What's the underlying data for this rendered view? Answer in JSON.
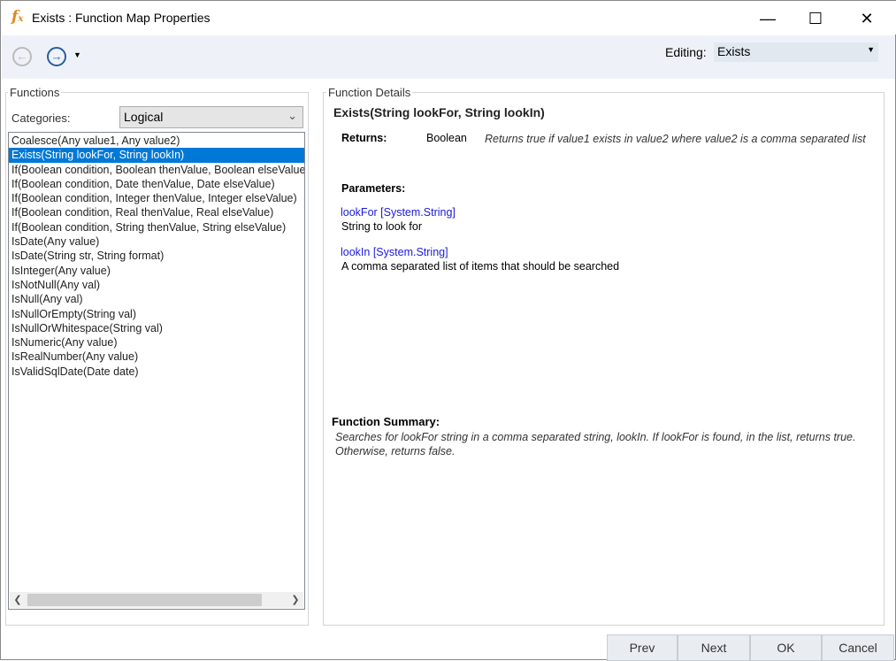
{
  "window": {
    "title": "Exists : Function Map Properties",
    "icon": "fx-icon",
    "controls": [
      "minimize",
      "maximize",
      "close"
    ]
  },
  "toolbar": {
    "back_icon": "back-arrow-icon",
    "forward_icon": "forward-arrow-icon",
    "editing_label": "Editing:",
    "editing_value": "Exists"
  },
  "functions": {
    "group_label": "Functions",
    "categories_label": "Categories:",
    "category_value": "Logical",
    "items": [
      "Coalesce(Any value1, Any value2)",
      "Exists(String lookFor, String lookIn)",
      "If(Boolean condition, Boolean thenValue, Boolean elseValue)",
      "If(Boolean condition, Date thenValue, Date elseValue)",
      "If(Boolean condition, Integer thenValue, Integer elseValue)",
      "If(Boolean condition, Real thenValue, Real elseValue)",
      "If(Boolean condition, String thenValue, String elseValue)",
      "IsDate(Any value)",
      "IsDate(String str, String format)",
      "IsInteger(Any value)",
      "IsNotNull(Any val)",
      "IsNull(Any val)",
      "IsNullOrEmpty(String val)",
      "IsNullOrWhitespace(String val)",
      "IsNumeric(Any value)",
      "IsRealNumber(Any value)",
      "IsValidSqlDate(Date date)"
    ],
    "selected_index": 1
  },
  "details": {
    "group_label": "Function Details",
    "signature": "Exists(String lookFor, String lookIn)",
    "returns_label": "Returns:",
    "returns_type": "Boolean",
    "returns_desc": "Returns true if value1 exists in value2 where value2 is a comma separated list",
    "parameters_label": "Parameters:",
    "params": [
      {
        "name": "lookFor [System.String]",
        "desc": "String to look for"
      },
      {
        "name": "lookIn [System.String]",
        "desc": "A comma separated list of items that should be searched"
      }
    ],
    "summary_label": "Function Summary:",
    "summary": "Searches for lookFor string in a comma separated string, lookIn. If lookFor is found, in the list, returns true. Otherwise, returns false."
  },
  "buttons": {
    "prev": "Prev",
    "next": "Next",
    "ok": "OK",
    "cancel": "Cancel"
  }
}
